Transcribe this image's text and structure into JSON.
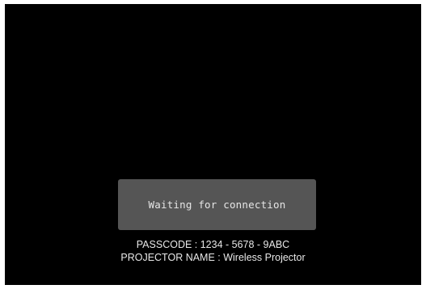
{
  "status": {
    "message": "Waiting for connection"
  },
  "info": {
    "passcode_line": "PASSCODE : 1234 - 5678 - 9ABC",
    "projector_name_line": "PROJECTOR NAME : Wireless Projector"
  },
  "colors": {
    "screen_background": "#000000",
    "status_box": "#555555",
    "text": "#e8e8e8"
  }
}
